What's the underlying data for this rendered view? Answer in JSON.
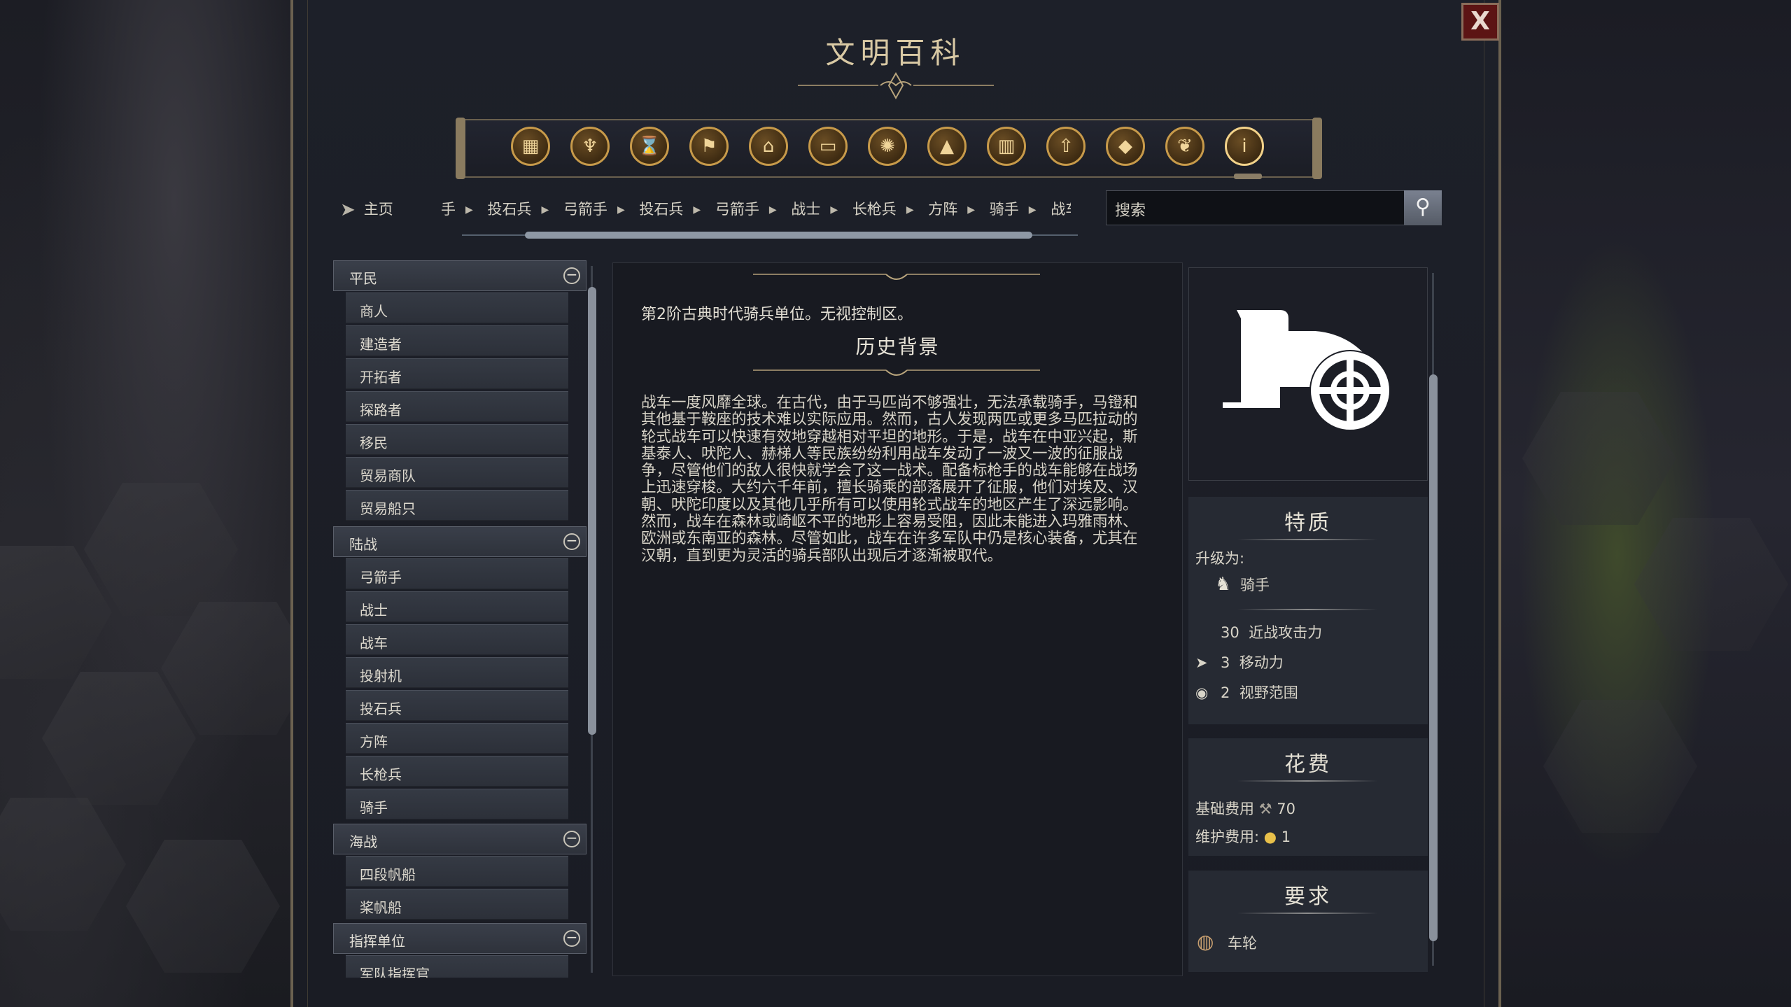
{
  "window": {
    "title": "文明百科",
    "close_label": "X"
  },
  "categories": [
    {
      "icon": "crate-icon"
    },
    {
      "icon": "goblet-icon"
    },
    {
      "icon": "hourglass-icon"
    },
    {
      "icon": "flag-icon"
    },
    {
      "icon": "temple-icon"
    },
    {
      "icon": "book-icon"
    },
    {
      "icon": "atom-icon"
    },
    {
      "icon": "mountain-icon"
    },
    {
      "icon": "building-icon"
    },
    {
      "icon": "arrow-up-icon"
    },
    {
      "icon": "diamond-icon"
    },
    {
      "icon": "dove-icon"
    },
    {
      "icon": "info-icon"
    }
  ],
  "nav": {
    "home_label": "主页",
    "breadcrumbs": [
      "手",
      "投石兵",
      "弓箭手",
      "投石兵",
      "弓箭手",
      "战士",
      "长枪兵",
      "方阵",
      "骑手",
      "战车"
    ],
    "search_placeholder": "搜索"
  },
  "sidebar": {
    "groups": [
      {
        "label": "平民",
        "items": [
          "商人",
          "建造者",
          "开拓者",
          "探路者",
          "移民",
          "贸易商队",
          "贸易船只"
        ]
      },
      {
        "label": "陆战",
        "items": [
          "弓箭手",
          "战士",
          "战车",
          "投射机",
          "投石兵",
          "方阵",
          "长枪兵",
          "骑手"
        ]
      },
      {
        "label": "海战",
        "items": [
          "四段帆船",
          "桨帆船"
        ]
      },
      {
        "label": "指挥单位",
        "items": [
          "军队指挥官"
        ]
      }
    ]
  },
  "article": {
    "summary": "第2阶古典时代骑兵单位。无视控制区。",
    "history_title": "历史背景",
    "history_text": "战车一度风靡全球。在古代，由于马匹尚不够强壮，无法承载骑手，马镫和其他基于鞍座的技术难以实际应用。然而，古人发现两匹或更多马匹拉动的轮式战车可以快速有效地穿越相对平坦的地形。于是，战车在中亚兴起，斯基泰人、吠陀人、赫梯人等民族纷纷利用战车发动了一波又一波的征服战争，尽管他们的敌人很快就学会了这一战术。配备标枪手的战车能够在战场上迅速穿梭。大约六千年前，擅长骑乘的部落展开了征服，他们对埃及、汉朝、吠陀印度以及其他几乎所有可以使用轮式战车的地区产生了深远影响。然而，战车在森林或崎岖不平的地形上容易受阻，因此未能进入玛雅雨林、欧洲或东南亚的森林。尽管如此，战车在许多军队中仍是核心装备，尤其在汉朝，直到更为灵活的骑兵部队出现后才逐渐被取代。"
  },
  "traits": {
    "title": "特质",
    "upgrade_label": "升级为:",
    "upgrade_unit": "骑手",
    "stats": [
      {
        "value": "30",
        "label": "近战攻击力",
        "icon": "sword-icon"
      },
      {
        "value": "3",
        "label": "移动力",
        "icon": "movement-icon"
      },
      {
        "value": "2",
        "label": "视野范围",
        "icon": "eye-icon"
      }
    ]
  },
  "cost": {
    "title": "花费",
    "base_label": "基础费用",
    "base_value": "70",
    "upkeep_label": "维护费用:",
    "upkeep_value": "1"
  },
  "requirements": {
    "title": "要求",
    "tech": "车轮"
  }
}
